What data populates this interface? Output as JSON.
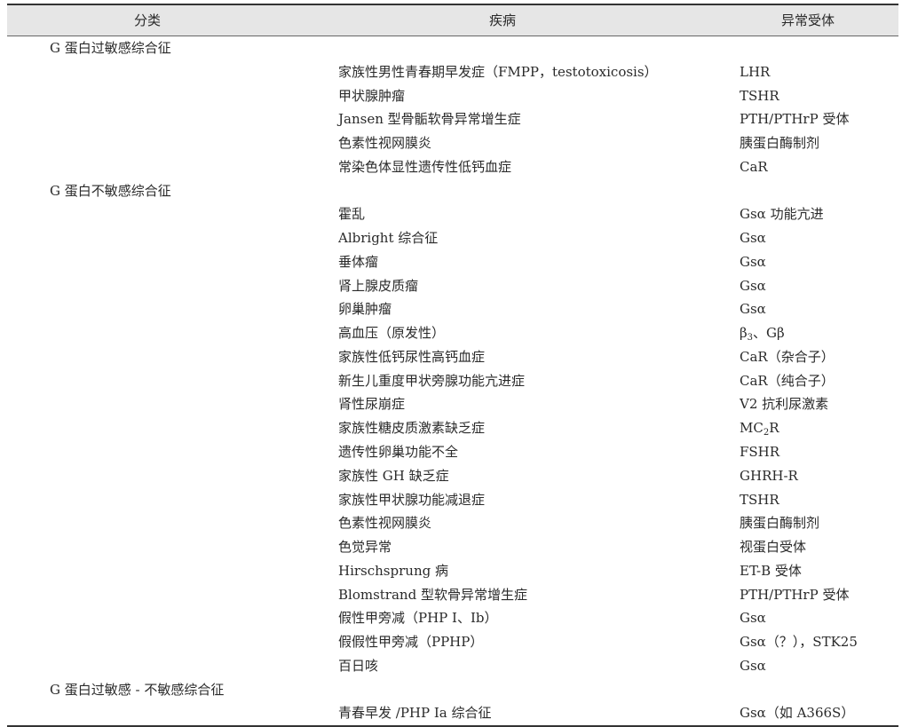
{
  "headers": {
    "category": "分类",
    "disease": "疾病",
    "receptor": "异常受体"
  },
  "groups": [
    {
      "title": "G 蛋白过敏感综合征",
      "rows": [
        {
          "disease": "家族性男性青春期早发症（FMPP，testotoxicosis）",
          "receptor": "LHR"
        },
        {
          "disease": "甲状腺肿瘤",
          "receptor": "TSHR"
        },
        {
          "disease": "Jansen 型骨骺软骨异常增生症",
          "receptor": "PTH/PTHrP 受体"
        },
        {
          "disease": "色素性视网膜炎",
          "receptor": "胰蛋白酶制剂"
        },
        {
          "disease": "常染色体显性遗传性低钙血症",
          "receptor": "CaR"
        }
      ]
    },
    {
      "title": "G 蛋白不敏感综合征",
      "rows": [
        {
          "disease": "霍乱",
          "receptor": "Gsα 功能亢进"
        },
        {
          "disease": "Albright 综合征",
          "receptor": "Gsα"
        },
        {
          "disease": "垂体瘤",
          "receptor": "Gsα"
        },
        {
          "disease": "肾上腺皮质瘤",
          "receptor": "Gsα"
        },
        {
          "disease": "卵巢肿瘤",
          "receptor": "Gsα"
        },
        {
          "disease": "高血压（原发性）",
          "receptor_main": "β",
          "receptor_sub": "3",
          "receptor_tail": "、Gβ"
        },
        {
          "disease": "家族性低钙尿性高钙血症",
          "receptor": "CaR（杂合子）"
        },
        {
          "disease": "新生儿重度甲状旁腺功能亢进症",
          "receptor": "CaR（纯合子）"
        },
        {
          "disease": "肾性尿崩症",
          "receptor": "V2 抗利尿激素"
        },
        {
          "disease": "家族性糖皮质激素缺乏症",
          "receptor_main": "MC",
          "receptor_sub": "2",
          "receptor_tail": "R"
        },
        {
          "disease": "遗传性卵巢功能不全",
          "receptor": "FSHR"
        },
        {
          "disease": "家族性 GH 缺乏症",
          "receptor": "GHRH-R"
        },
        {
          "disease": "家族性甲状腺功能减退症",
          "receptor": "TSHR"
        },
        {
          "disease": "色素性视网膜炎",
          "receptor": "胰蛋白酶制剂"
        },
        {
          "disease": "色觉异常",
          "receptor": "视蛋白受体"
        },
        {
          "disease": "Hirschsprung 病",
          "receptor": "ET-B 受体"
        },
        {
          "disease": "Blomstrand 型软骨异常增生症",
          "receptor": "PTH/PTHrP 受体"
        },
        {
          "disease": "假性甲旁减（PHP Ⅰ、Ⅰb）",
          "receptor": "Gsα"
        },
        {
          "disease": "假假性甲旁减（PPHP）",
          "receptor": "Gsα（？），STK25"
        },
        {
          "disease": "百日咳",
          "receptor": "Gsα"
        }
      ]
    },
    {
      "title": "G 蛋白过敏感 - 不敏感综合征",
      "rows": [
        {
          "disease": "青春早发 /PHP Ⅰa 综合征",
          "receptor": "Gsα（如 A366S）"
        }
      ]
    }
  ]
}
